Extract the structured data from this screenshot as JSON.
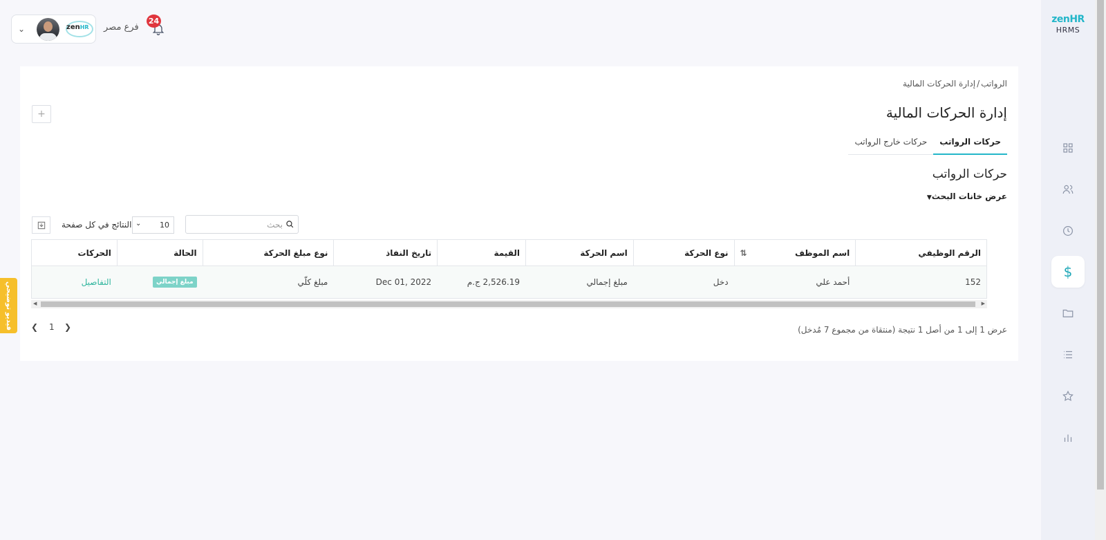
{
  "app": {
    "logo_main": "zen",
    "logo_accent": "HR",
    "logo_sub": "HRMS"
  },
  "header": {
    "branch": "فرع مصر",
    "notifications_count": "24",
    "brand_main": "zen",
    "brand_accent": "HR"
  },
  "sidebar": {
    "items": [
      {
        "icon": "grid-icon"
      },
      {
        "icon": "users-icon"
      },
      {
        "icon": "clock-icon"
      },
      {
        "icon": "dollar-icon",
        "symbol": "$",
        "active": true
      },
      {
        "icon": "folder-icon"
      },
      {
        "icon": "list-icon"
      },
      {
        "icon": "star-icon"
      },
      {
        "icon": "bar-chart-icon"
      }
    ]
  },
  "page": {
    "breadcrumb_parent": "الرواتب",
    "breadcrumb_sep": "/",
    "breadcrumb_current": "إدارة الحركات المالية",
    "title": "إدارة الحركات المالية",
    "add_label": "+"
  },
  "tabs": [
    {
      "label": "حركات الرواتب",
      "active": true
    },
    {
      "label": "حركات خارج الرواتب",
      "active": false
    }
  ],
  "section": {
    "title": "حركات الرواتب",
    "filter_toggle": "عرض خانات البحث"
  },
  "toolbar": {
    "search_placeholder": "بحث",
    "per_page_value": "10",
    "per_page_label": "النتائج في كل صفحة"
  },
  "table": {
    "headers": [
      "الرقم الوظيفي",
      "اسم الموظف",
      "نوع الحركة",
      "اسم الحركة",
      "القيمة",
      "تاريخ النفاذ",
      "نوع مبلغ الحركة",
      "الحالة",
      "الحركات"
    ],
    "rows": [
      {
        "employee_id": "152",
        "employee_name": "أحمد علي",
        "type": "دخل",
        "name": "مبلغ إجمالي",
        "value": "2,526.19 ج.م",
        "effective_date": "Dec 01, 2022",
        "amount_type": "مبلغ كلّي",
        "status": "مبلغ إجمالي",
        "action": "التفاصيل"
      }
    ]
  },
  "footer": {
    "info": "عرض 1 إلى 1 من أصل 1 نتيجة (منتقاة من مجموع 7 مُدخل)",
    "current_page": "1"
  },
  "video_tab": {
    "label": "فيديو توضيحي"
  },
  "colors": {
    "accent": "#23b6c9",
    "badge": "#e0363e",
    "status_pill": "#7dd3c8",
    "link": "#2fb59d",
    "video_tab": "#f6bf2b"
  }
}
